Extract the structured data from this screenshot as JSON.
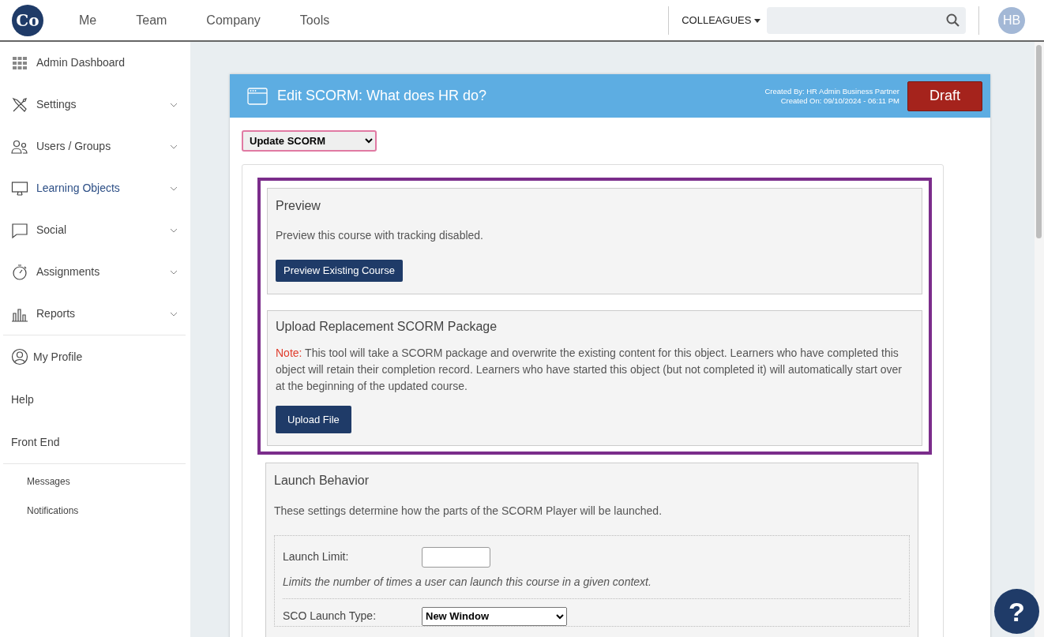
{
  "logo": {
    "text": "Co"
  },
  "nav": [
    {
      "label": "Me"
    },
    {
      "label": "Team"
    },
    {
      "label": "Company"
    },
    {
      "label": "Tools"
    }
  ],
  "colleagues": {
    "label": "COLLEAGUES"
  },
  "avatar": {
    "initials": "HB"
  },
  "sidebar": {
    "items": [
      {
        "label": "Admin Dashboard",
        "has_menu": false,
        "selected": false
      },
      {
        "label": "Settings",
        "has_menu": true,
        "selected": false
      },
      {
        "label": "Users / Groups",
        "has_menu": true,
        "selected": false
      },
      {
        "label": "Learning Objects",
        "has_menu": true,
        "selected": true
      },
      {
        "label": "Social",
        "has_menu": true,
        "selected": false
      },
      {
        "label": "Assignments",
        "has_menu": true,
        "selected": false
      },
      {
        "label": "Reports",
        "has_menu": true,
        "selected": false
      }
    ],
    "links": [
      {
        "label": "My Profile"
      },
      {
        "label": "Help"
      },
      {
        "label": "Front End"
      }
    ],
    "small_links": [
      {
        "label": "Messages"
      },
      {
        "label": "Notifications"
      }
    ]
  },
  "header": {
    "title": "Edit SCORM: What does HR do?",
    "created_by": "Created By: HR Admin Business Partner",
    "created_on": "Created On: 09/10/2024 - 06:11 PM",
    "status": "Draft"
  },
  "action_select": {
    "value": "Update SCORM"
  },
  "preview": {
    "title": "Preview",
    "text": "Preview this course with tracking disabled.",
    "button": "Preview Existing Course"
  },
  "upload": {
    "title": "Upload Replacement SCORM Package",
    "note_label": "Note:",
    "note": "This tool will take a SCORM package and overwrite the existing content for this object. Learners who have completed this object will retain their completion record. Learners who have started this object (but not completed it) will automatically start over at the beginning of the updated course.",
    "button": "Upload File"
  },
  "launch": {
    "title": "Launch Behavior",
    "text": "These settings determine how the parts of the SCORM Player will be launched.",
    "fields": [
      {
        "label": "Launch Limit:",
        "kind": "text",
        "hint": "Limits the number of times a user can launch this course in a given context."
      },
      {
        "label": "SCO Launch Type:",
        "kind": "select",
        "value": "New Window"
      }
    ]
  },
  "help_button": {
    "label": "?"
  }
}
